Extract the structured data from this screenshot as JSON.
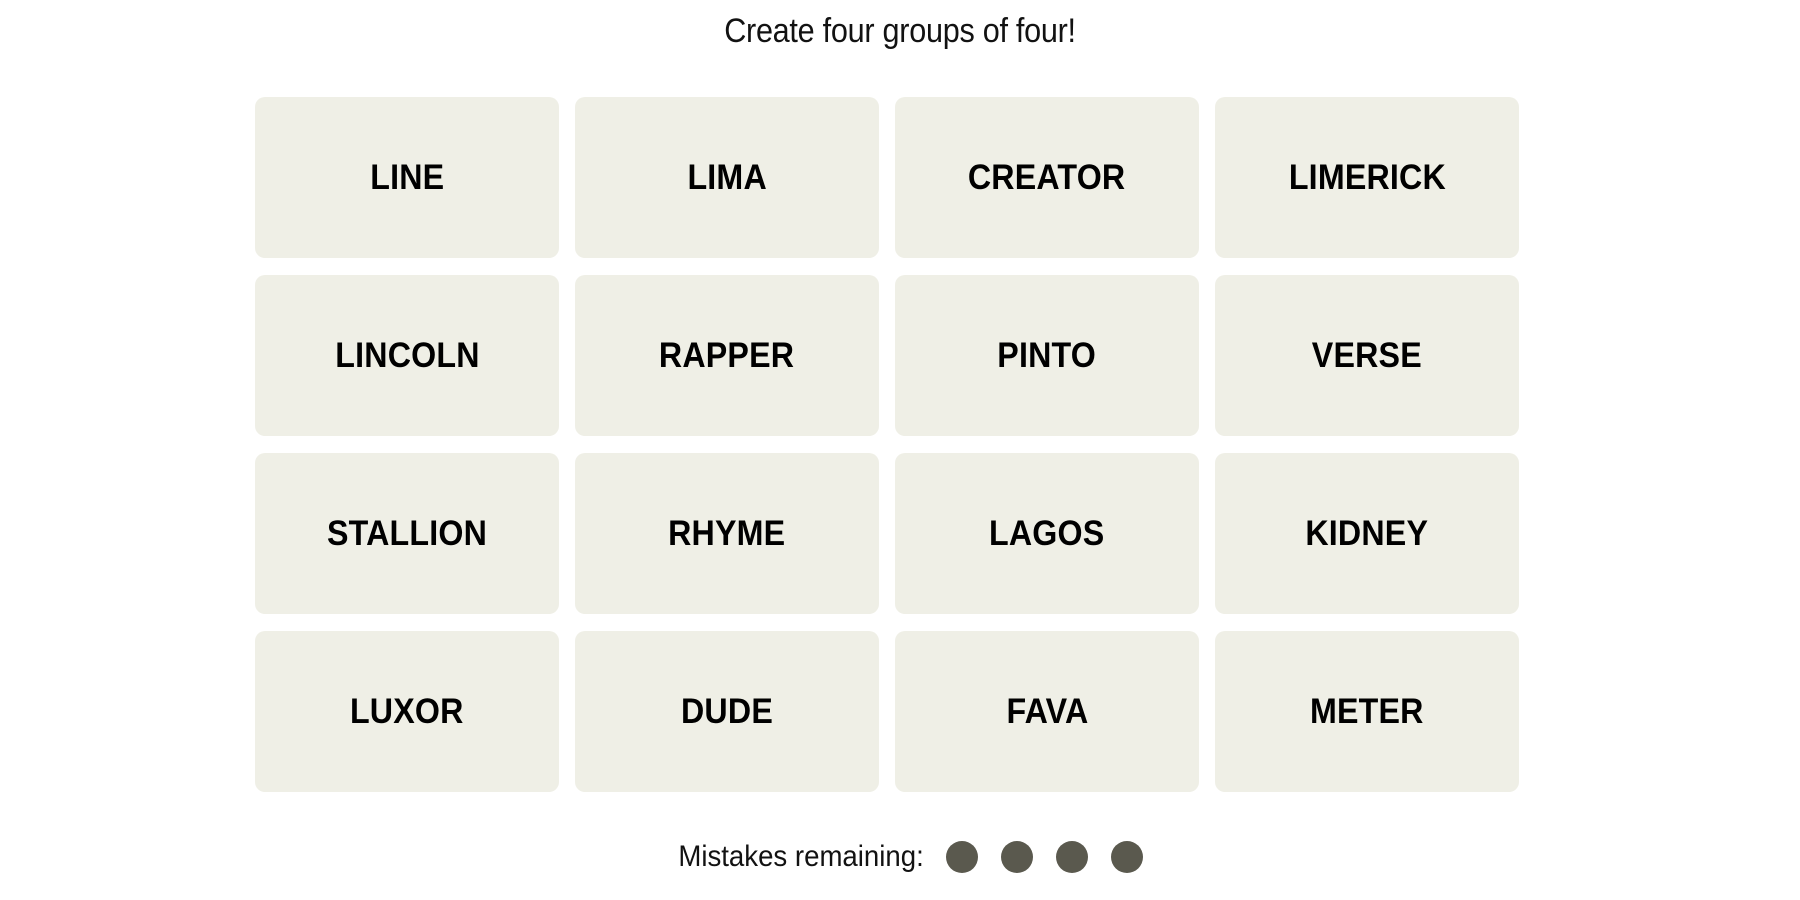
{
  "game": {
    "subtitle": "Create four groups of four!",
    "tiles": [
      [
        "LINE",
        "LIMA",
        "CREATOR",
        "LIMERICK"
      ],
      [
        "LINCOLN",
        "RAPPER",
        "PINTO",
        "VERSE"
      ],
      [
        "STALLION",
        "RHYME",
        "LAGOS",
        "KIDNEY"
      ],
      [
        "LUXOR",
        "DUDE",
        "FAVA",
        "METER"
      ]
    ],
    "mistakes": {
      "label": "Mistakes remaining:",
      "remaining": 4,
      "total": 4
    }
  },
  "colors": {
    "tile_background": "#efefe6",
    "tile_text": "#000000",
    "mistake_dot": "#5a594e",
    "page_background": "#ffffff"
  }
}
